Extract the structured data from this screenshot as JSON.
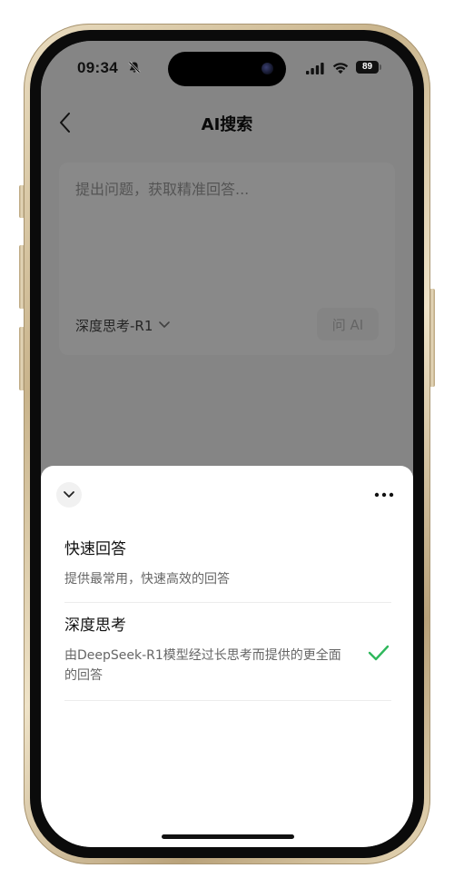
{
  "status_bar": {
    "time": "09:34",
    "battery": "89",
    "icons": [
      "bell-mute-icon",
      "signal-icon",
      "wifi-icon",
      "battery-icon"
    ]
  },
  "nav": {
    "back_icon": "chevron-left-icon",
    "title": "AI搜索"
  },
  "question": {
    "placeholder": "提出问题，获取精准回答...",
    "model_label": "深度思考-R1",
    "model_icon": "chevron-down-icon",
    "ask_label": "问 AI"
  },
  "sheet": {
    "collapse_icon": "chevron-down-icon",
    "more_icon": "more-horizontal-icon",
    "options": [
      {
        "title": "快速回答",
        "description": "提供最常用，快速高效的回答",
        "selected": false
      },
      {
        "title": "深度思考",
        "description": "由DeepSeek-R1模型经过长思考而提供的更全面的回答",
        "selected": true
      }
    ]
  },
  "colors": {
    "check": "#2fb85c",
    "overlay": "rgba(0,0,0,0.45)",
    "frame_gold": "#c9b48c"
  }
}
